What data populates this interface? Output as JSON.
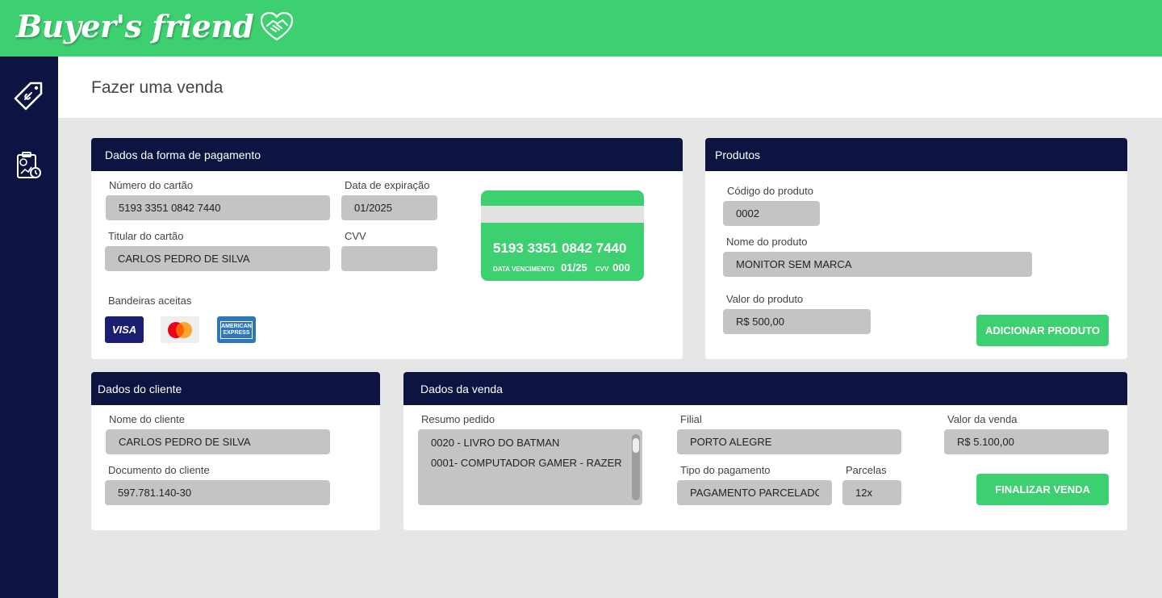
{
  "app": {
    "brand": "Buyer's friend",
    "brand_icon": "handshake-heart-icon",
    "accent": "#3dd070",
    "navy": "#0e1442"
  },
  "sidebar": {
    "items": [
      {
        "icon": "price-tag-icon"
      },
      {
        "icon": "sales-report-icon"
      }
    ]
  },
  "page": {
    "title": "Fazer uma venda"
  },
  "payment": {
    "title": "Dados da forma de pagamento",
    "card_number_label": "Número do cartão",
    "card_number_value": "5193 3351 0842 7440",
    "expiry_label": "Data de expiração",
    "expiry_value": "01/2025",
    "holder_label": "Titular do cartão",
    "holder_value": "CARLOS PEDRO DE SILVA",
    "cvv_label": "CVV",
    "cvv_value": "",
    "brands_label": "Bandeiras aceitas",
    "brands": [
      {
        "name": "VISA",
        "icon": "visa-icon"
      },
      {
        "name": "",
        "icon": "mastercard-icon"
      },
      {
        "name": "AMERICAN EXPRESS",
        "icon": "amex-icon"
      }
    ],
    "preview": {
      "number": "5193 3351 0842 7440",
      "expiry_label": "DATA VENCIMENTO",
      "expiry_value": "01/25",
      "cvv_label": "CVV",
      "cvv_value": "000"
    }
  },
  "products": {
    "title": "Produtos",
    "code_label": "Código do produto",
    "code_value": "0002",
    "name_label": "Nome do produto",
    "name_value": "MONITOR SEM MARCA",
    "price_label": "Valor do produto",
    "price_value": "R$ 500,00",
    "add_button": "ADICIONAR PRODUTO"
  },
  "client": {
    "title": "Dados do cliente",
    "name_label": "Nome do cliente",
    "name_value": "CARLOS PEDRO DE SILVA",
    "doc_label": "Documento do cliente",
    "doc_value": "597.781.140-30"
  },
  "sale": {
    "title": "Dados da venda",
    "summary_label": "Resumo pedido",
    "summary_items": [
      "0020 - LIVRO DO BATMAN",
      "0001- COMPUTADOR GAMER - RAZER"
    ],
    "branch_label": "Filial",
    "branch_value": "PORTO ALEGRE",
    "total_label": "Valor da venda",
    "total_value": "R$ 5.100,00",
    "payment_type_label": "Tipo do pagamento",
    "payment_type_value": "PAGAMENTO PARCELADO",
    "installments_label": "Parcelas",
    "installments_value": "12x",
    "finish_button": "FINALIZAR VENDA"
  }
}
